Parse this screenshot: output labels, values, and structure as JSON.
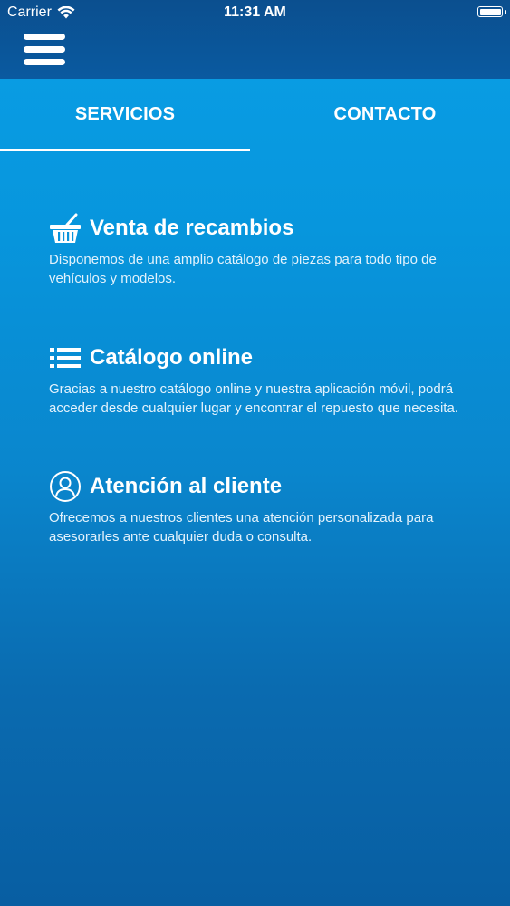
{
  "status_bar": {
    "carrier": "Carrier",
    "time": "11:31 AM",
    "wifi_icon": "wifi-icon",
    "battery_icon": "battery-icon"
  },
  "header": {
    "menu_icon": "hamburger-menu-icon"
  },
  "tabs": [
    {
      "label": "SERVICIOS",
      "selected": true
    },
    {
      "label": "CONTACTO",
      "selected": false
    }
  ],
  "services": [
    {
      "icon": "basket-icon",
      "title": "Venta de recambios",
      "description": "Disponemos de una amplio catálogo de piezas para todo tipo de vehículos y modelos."
    },
    {
      "icon": "list-icon",
      "title": "Catálogo online",
      "description": "Gracias a nuestro catálogo online y nuestra aplicación móvil, podrá acceder desde cualquier lugar y encontrar el repuesto que necesita."
    },
    {
      "icon": "user-circle-icon",
      "title": "Atención al cliente",
      "description": "Ofrecemos a nuestros clientes una atención personalizada para asesorarles ante cualquier duda o consulta."
    }
  ],
  "colors": {
    "header": "#0a5aa0",
    "background_top": "#0a9fe6",
    "background_bottom": "#085ea2",
    "text": "#ffffff"
  }
}
